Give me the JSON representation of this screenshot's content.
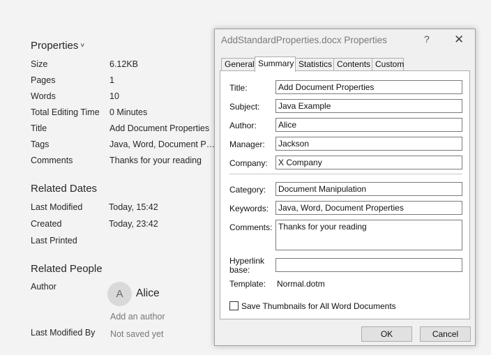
{
  "info": {
    "properties_title": "Properties",
    "properties_chevron": "˅",
    "props": [
      {
        "label": "Size",
        "value": "6.12KB"
      },
      {
        "label": "Pages",
        "value": "1"
      },
      {
        "label": "Words",
        "value": "10"
      },
      {
        "label": "Total Editing Time",
        "value": "0 Minutes"
      },
      {
        "label": "Title",
        "value": "Add Document Properties"
      },
      {
        "label": "Tags",
        "value": "Java, Word, Document Pro..."
      },
      {
        "label": "Comments",
        "value": "Thanks for your reading"
      }
    ],
    "related_dates_title": "Related Dates",
    "dates": [
      {
        "label": "Last Modified",
        "value": "Today, 15:42"
      },
      {
        "label": "Created",
        "value": "Today, 23:42"
      },
      {
        "label": "Last Printed",
        "value": ""
      }
    ],
    "related_people_title": "Related People",
    "author_label": "Author",
    "author_initial": "A",
    "author_name": "Alice",
    "add_author": "Add an author",
    "last_modified_by_label": "Last Modified By",
    "last_modified_by_value": "Not saved yet"
  },
  "dialog": {
    "title": "AddStandardProperties.docx Properties",
    "help": "?",
    "close": "✕",
    "tabs": [
      "General",
      "Summary",
      "Statistics",
      "Contents",
      "Custom"
    ],
    "active_tab": "Summary",
    "fields": {
      "title": {
        "label": "Title:",
        "value": "Add Document Properties"
      },
      "subject": {
        "label": "Subject:",
        "value": "Java Example"
      },
      "author": {
        "label": "Author:",
        "value": "Alice"
      },
      "manager": {
        "label": "Manager:",
        "value": "Jackson"
      },
      "company": {
        "label": "Company:",
        "value": "X Company"
      },
      "category": {
        "label": "Category:",
        "value": "Document Manipulation"
      },
      "keywords": {
        "label": "Keywords:",
        "value": "Java, Word, Document Properties"
      },
      "comments": {
        "label": "Comments:",
        "value": "Thanks for your reading"
      },
      "hyperlink": {
        "label_line1": "Hyperlink",
        "label_line2": "base:",
        "value": ""
      },
      "template": {
        "label": "Template:",
        "value": "Normal.dotm"
      }
    },
    "save_thumbnails": {
      "label": "Save Thumbnails for All Word Documents",
      "checked": false
    },
    "ok": "OK",
    "cancel": "Cancel"
  }
}
